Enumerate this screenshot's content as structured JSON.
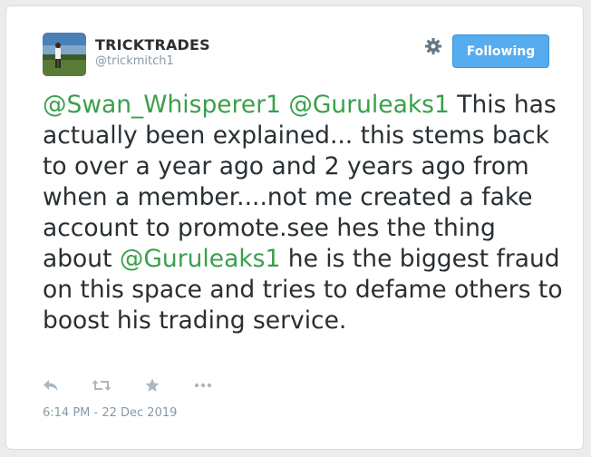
{
  "user": {
    "display_name": "TRICKTRADES",
    "handle": "@trickmitch1",
    "avatar_icon": "profile-photo"
  },
  "follow_button": {
    "label": "Following",
    "color": "#55acee"
  },
  "tweet": {
    "segments": [
      {
        "type": "mention",
        "text": "@Swan_Whisperer1"
      },
      {
        "type": "text",
        "text": " "
      },
      {
        "type": "mention",
        "text": "@Guruleaks1"
      },
      {
        "type": "text",
        "text": " This has actually been explained... this stems back to over a year ago and 2 years ago from when a member....not me created a fake account to promote.see hes the thing about "
      },
      {
        "type": "mention",
        "text": "@Guruleaks1"
      },
      {
        "type": "text",
        "text": " he is the biggest fraud on this space and tries to defame others to boost his trading service."
      }
    ],
    "mention_color": "#3aa04a",
    "timestamp": "6:14 PM - 22 Dec 2019"
  },
  "actions": [
    {
      "name": "reply-icon"
    },
    {
      "name": "retweet-icon"
    },
    {
      "name": "favorite-icon"
    },
    {
      "name": "more-icon"
    }
  ]
}
